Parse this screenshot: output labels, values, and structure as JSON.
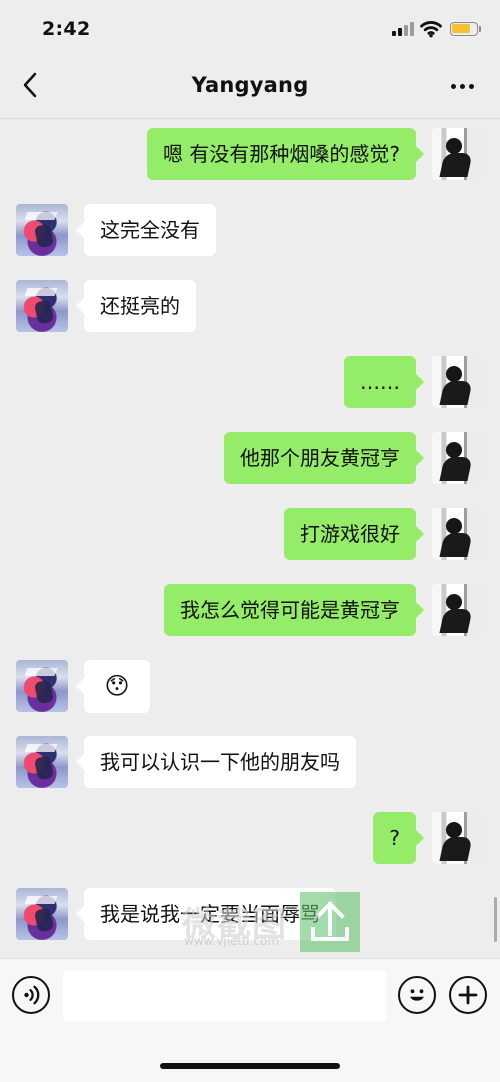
{
  "status_bar": {
    "time": "2:42",
    "battery_level_percent": 80,
    "battery_color": "#f4c22c"
  },
  "header": {
    "title": "Yangyang"
  },
  "messages": [
    {
      "side": "right",
      "text": "嗯 有没有那种烟嗓的感觉?"
    },
    {
      "side": "left",
      "text": "这完全没有"
    },
    {
      "side": "left",
      "text": "还挺亮的"
    },
    {
      "side": "right",
      "text": "……"
    },
    {
      "side": "right",
      "text": "他那个朋友黄冠亨"
    },
    {
      "side": "right",
      "text": "打游戏很好"
    },
    {
      "side": "right",
      "text": "我怎么觉得可能是黄冠亨"
    },
    {
      "side": "left",
      "text": "😯"
    },
    {
      "side": "left",
      "text": "我可以认识一下他的朋友吗"
    },
    {
      "side": "right",
      "text": "?"
    },
    {
      "side": "left",
      "text": "我是说我一定要当面辱骂"
    }
  ],
  "composer": {
    "input_value": ""
  },
  "watermark": {
    "text": "微截图",
    "subtext": "www.vjietu.com"
  },
  "icons": {
    "back": "chevron-left-icon",
    "more": "more-icon",
    "voice": "voice-icon",
    "emoji": "emoji-icon",
    "plus": "plus-icon"
  },
  "colors": {
    "background": "#ededed",
    "right_bubble": "#95ec69",
    "left_bubble": "#ffffff",
    "watermark_green": "#62c26e"
  }
}
